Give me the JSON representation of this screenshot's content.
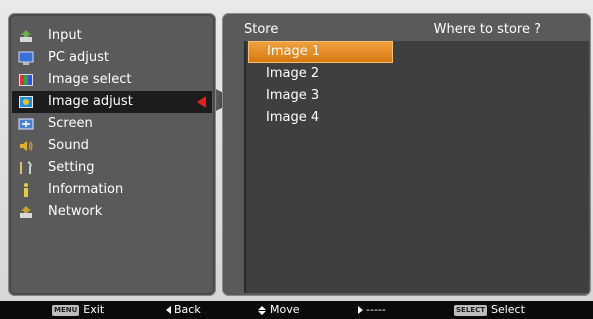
{
  "menu": {
    "items": [
      {
        "label": "Input",
        "icon": "input-icon"
      },
      {
        "label": "PC adjust",
        "icon": "pc-adjust-icon"
      },
      {
        "label": "Image select",
        "icon": "image-select-icon"
      },
      {
        "label": "Image adjust",
        "icon": "image-adjust-icon",
        "active": true
      },
      {
        "label": "Screen",
        "icon": "screen-icon"
      },
      {
        "label": "Sound",
        "icon": "sound-icon"
      },
      {
        "label": "Setting",
        "icon": "setting-icon"
      },
      {
        "label": "Information",
        "icon": "information-icon"
      },
      {
        "label": "Network",
        "icon": "network-icon"
      }
    ]
  },
  "panel": {
    "title": "Store",
    "hint": "Where to store ?",
    "items": [
      "Image 1",
      "Image 2",
      "Image 3",
      "Image 4"
    ],
    "selected_index": 0
  },
  "footer": {
    "exit_key": "MENU",
    "exit_label": "Exit",
    "back_label": "Back",
    "move_label": "Move",
    "right_label": "-----",
    "select_key": "SELECT",
    "select_label": "Select"
  },
  "colors": {
    "accent": "#e07a10",
    "active_arrow": "#e02020",
    "panel": "#5a5a5a",
    "list_bg": "#3f3f3f"
  }
}
